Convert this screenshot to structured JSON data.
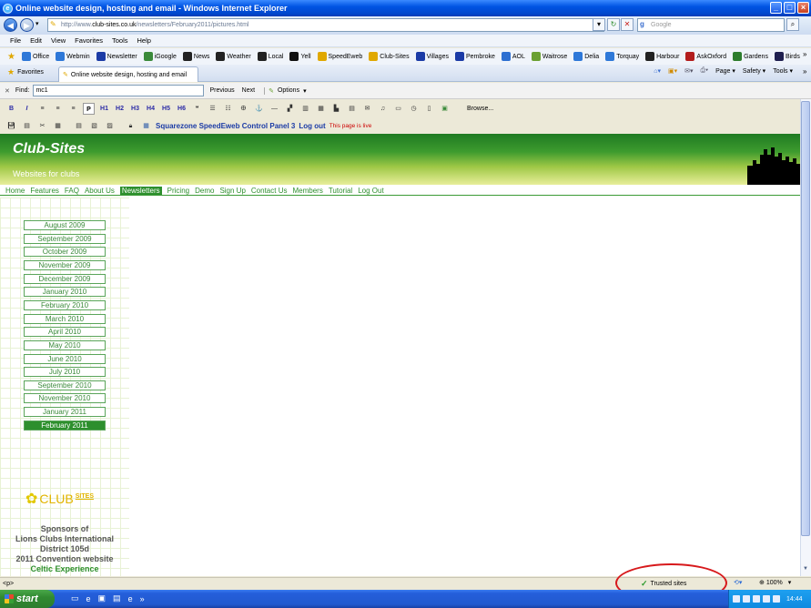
{
  "window": {
    "title": "Online website design, hosting and email - Windows Internet Explorer"
  },
  "address": {
    "url_prefix": "http://www.",
    "url_domain": "club-sites.co.uk",
    "url_path": "/newsletters/February2011/pictures.html",
    "search_placeholder": "Google"
  },
  "menu": [
    "File",
    "Edit",
    "View",
    "Favorites",
    "Tools",
    "Help"
  ],
  "links": [
    {
      "label": "Office",
      "icon": "ie-page-icon",
      "color": "#2e78d8"
    },
    {
      "label": "Webmin",
      "icon": "ie-page-icon",
      "color": "#2e78d8"
    },
    {
      "label": "Newsletter",
      "icon": "s-logo-icon",
      "color": "#1b3ba6"
    },
    {
      "label": "iGoogle",
      "icon": "igoogle-icon",
      "color": "#3a8a3a"
    },
    {
      "label": "News",
      "icon": "bbc-icon",
      "color": "#222222"
    },
    {
      "label": "Weather",
      "icon": "bbc-icon",
      "color": "#222222"
    },
    {
      "label": "Local",
      "icon": "bbc-icon",
      "color": "#222222"
    },
    {
      "label": "Yell",
      "icon": "yell-icon",
      "color": "#111111"
    },
    {
      "label": "SpeedEweb",
      "icon": "pin-icon",
      "color": "#e0a800"
    },
    {
      "label": "Club-Sites",
      "icon": "pin-icon",
      "color": "#e0a800"
    },
    {
      "label": "Villages",
      "icon": "s-logo-icon",
      "color": "#1b3ba6"
    },
    {
      "label": "Pembroke",
      "icon": "s-logo-icon",
      "color": "#1b3ba6"
    },
    {
      "label": "AOL",
      "icon": "aol-icon",
      "color": "#2d6fd1"
    },
    {
      "label": "Waitrose",
      "icon": "waitrose-icon",
      "color": "#6aa032"
    },
    {
      "label": "Delia",
      "icon": "ie-page-icon",
      "color": "#2e78d8"
    },
    {
      "label": "Torquay",
      "icon": "ie-page-icon",
      "color": "#2e78d8"
    },
    {
      "label": "Harbour",
      "icon": "bbc-icon",
      "color": "#222222"
    },
    {
      "label": "AskOxford",
      "icon": "book-icon",
      "color": "#b31d1d"
    },
    {
      "label": "Gardens",
      "icon": "rhs-icon",
      "color": "#2d7d2d"
    },
    {
      "label": "Birds",
      "icon": "bird-icon",
      "color": "#1f1f4f"
    }
  ],
  "tabs": {
    "favorites": "Favorites",
    "active_tab": "Online website design, hosting and email"
  },
  "commandbar": [
    "Page ▾",
    "Safety ▾",
    "Tools ▾"
  ],
  "find": {
    "label": "Find:",
    "value": "mc1",
    "previous": "Previous",
    "next": "Next",
    "options": "Options"
  },
  "editor": {
    "format_buttons": [
      "B",
      "I",
      "≡",
      "≡",
      "≡",
      "P",
      "H1",
      "H2",
      "H3",
      "H4",
      "H5",
      "H6"
    ],
    "browse": "Browse...",
    "cp_title": "Squarezone SpeedEweb Control Panel 3",
    "cp_logout": "Log out",
    "cp_live": "This page is live"
  },
  "site": {
    "brand": "Club-Sites",
    "tagline": "Websites for clubs",
    "nav": [
      "Home",
      "Features",
      "FAQ",
      "About Us",
      "Newsletters",
      "Pricing",
      "Demo",
      "Sign Up",
      "Contact Us",
      "Members",
      "Tutorial",
      "Log Out"
    ],
    "nav_active": "Newsletters",
    "months": [
      "August 2009",
      "September 2009",
      "October 2009",
      "November 2009",
      "December 2009",
      "January 2010",
      "February 2010",
      "March 2010",
      "April 2010",
      "May 2010",
      "June 2010",
      "July 2010",
      "September 2010",
      "November 2010",
      "January 2011",
      "February 2011"
    ],
    "month_active": "February 2011",
    "logo_club": "CLUB",
    "logo_sites": "SITES",
    "sponsor_lines": [
      "Sponsors of",
      "Lions Clubs International",
      "District 105d",
      "2011 Convention website"
    ],
    "sponsor_green": "Celtic Experience",
    "brand_color": "#2d8f2d"
  },
  "status": {
    "left": "<p>",
    "zone": "Trusted sites",
    "zoom": "100%"
  },
  "taskbar": {
    "start": "start",
    "clock": "14:44"
  }
}
